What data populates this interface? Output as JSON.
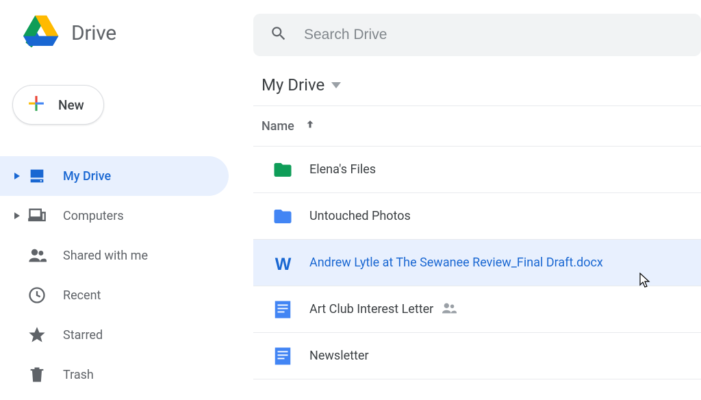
{
  "app_name": "Drive",
  "new_button_label": "New",
  "search_placeholder": "Search Drive",
  "location_label": "My Drive",
  "column_header": "Name",
  "sidebar": {
    "items": [
      {
        "label": "My Drive"
      },
      {
        "label": "Computers"
      },
      {
        "label": "Shared with me"
      },
      {
        "label": "Recent"
      },
      {
        "label": "Starred"
      },
      {
        "label": "Trash"
      }
    ]
  },
  "files": [
    {
      "name": "Elena's Files"
    },
    {
      "name": "Untouched Photos"
    },
    {
      "name": "Andrew Lytle at The Sewanee Review_Final Draft.docx"
    },
    {
      "name": "Art Club Interest Letter"
    },
    {
      "name": "Newsletter"
    }
  ]
}
